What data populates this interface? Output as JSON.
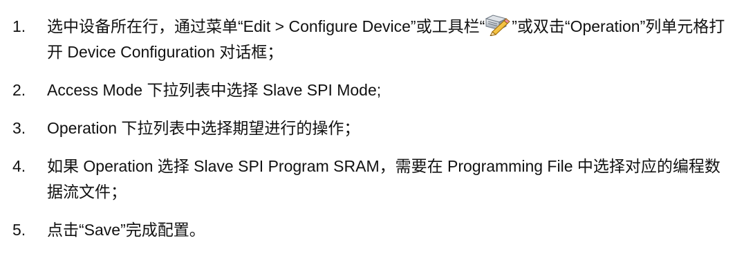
{
  "steps": [
    {
      "number": "1.",
      "text_before_icon": "选中设备所在行，通过菜单“Edit > Configure Device”或工具栏“",
      "icon": "edit-device-toolbar-icon",
      "text_after_icon": "”或双击“Operation”列单元格打开 Device Configuration 对话框；"
    },
    {
      "number": "2.",
      "text": "Access Mode 下拉列表中选择 Slave SPI Mode;"
    },
    {
      "number": "3.",
      "text": "Operation 下拉列表中选择期望进行的操作；"
    },
    {
      "number": "4.",
      "text": "如果 Operation 选择 Slave SPI Program SRAM，需要在 Programming File 中选择对应的编程数据流文件；"
    },
    {
      "number": "5.",
      "text": "点击“Save”完成配置。"
    }
  ]
}
